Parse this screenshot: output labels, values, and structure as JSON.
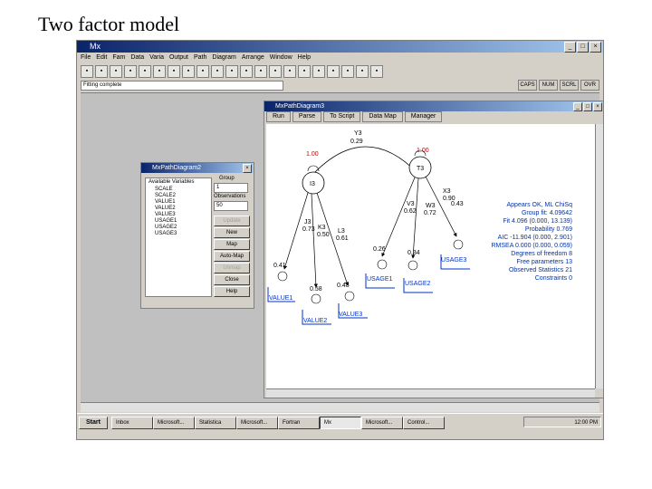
{
  "slide_title": "Two factor model",
  "app": {
    "title": "Mx",
    "menu": [
      "File",
      "Edit",
      "Fam",
      "Data",
      "Varia",
      "Output",
      "Path",
      "Diagram",
      "Arrange",
      "Window",
      "Help"
    ],
    "tool_icons": [
      "new-icon",
      "open-icon",
      "save-icon",
      "cut-icon",
      "copy-icon",
      "paste-icon",
      "undo-icon",
      "print-icon",
      "grid-icon",
      "table-icon",
      "select-icon",
      "arrow-icon",
      "circle-icon",
      "square-icon",
      "triangle-icon",
      "line-icon",
      "zoom-icon",
      "zoom-out-icon",
      "hand-icon",
      "pointer-icon",
      "cross-icon"
    ],
    "status_text": "Fitting complete",
    "status_buttons": [
      "CAPS",
      "NUM",
      "SCRL",
      "OVR"
    ]
  },
  "panel": {
    "title": "MxPathDiagram2",
    "list_header": "Available Variables",
    "variables": [
      "SCALE",
      "SCALE2",
      "VALUE1",
      "VALUE2",
      "VALUE3",
      "USAGE1",
      "USAGE2",
      "USAGE3"
    ],
    "group_label": "Group",
    "group_value": "1",
    "obs_label": "Observations",
    "obs_value": "50",
    "buttons": [
      "Update",
      "New",
      "Map",
      "Auto-Map",
      "Unmap",
      "Close",
      "Help"
    ]
  },
  "path": {
    "title": "MxPathDiagram3",
    "tabs": [
      "Run",
      "Parse",
      "To Script",
      "Data Map",
      "Manager"
    ],
    "factors": [
      {
        "name": "I3",
        "variance": "1.00"
      },
      {
        "name": "T3",
        "variance": "1.00"
      }
    ],
    "covariance": {
      "label": "Y3",
      "value": "0.29"
    },
    "loadings": [
      {
        "label": "0.41"
      },
      {
        "label": "0.58"
      },
      {
        "label": "0.48"
      },
      {
        "label": "0.26"
      },
      {
        "label": "0.34"
      }
    ],
    "path_labels": [
      {
        "label": "J3"
      },
      {
        "label": "0.73"
      },
      {
        "label": "K3"
      },
      {
        "label": "L3"
      },
      {
        "label": "0.50"
      },
      {
        "label": "0.61"
      },
      {
        "label": "V3"
      },
      {
        "label": "W3"
      },
      {
        "label": "0.62"
      },
      {
        "label": "0.72"
      },
      {
        "label": "X3"
      },
      {
        "label": "0.90"
      },
      {
        "label": "0.43"
      }
    ],
    "manifests": [
      "VALUE1",
      "VALUE2",
      "VALUE3",
      "USAGE1",
      "USAGE2",
      "USAGE3"
    ],
    "stats": [
      "Appears OK, ML ChiSq",
      "Group fit: 4.09642",
      "Fit 4.096 (0.000, 13.139)",
      "Probability 0.769",
      "AIC -11.904 (0.000, 2.901)",
      "RMSEA 0.000 (0.000, 0.059)",
      "Degrees of freedom 8",
      "Free parameters 13",
      "Observed Statistics 21",
      "Constraints 0"
    ]
  },
  "taskbar": {
    "start": "Start",
    "tasks": [
      "Inbox",
      "Microsoft...",
      "Statistica",
      "Microsoft...",
      "Fortran",
      "Mx",
      "Microsoft...",
      "Control..."
    ],
    "active_index": 5,
    "clock": "12:00 PM"
  },
  "colors": {
    "factor_label": "#cc0000",
    "manifest": "#0033cc",
    "stats_text": "#0033aa",
    "link": "#000000"
  }
}
